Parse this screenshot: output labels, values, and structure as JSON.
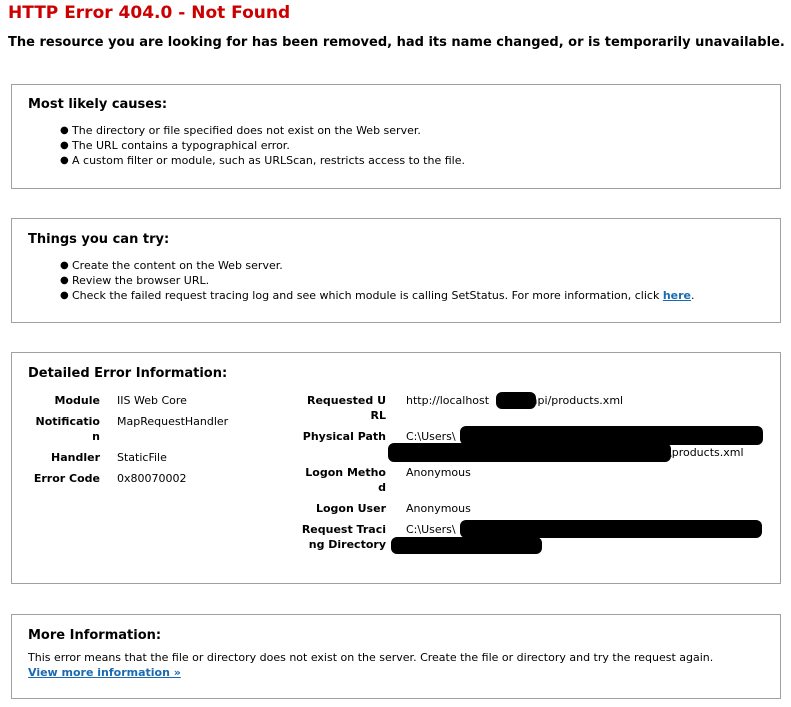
{
  "header": {
    "title": "HTTP Error 404.0 - Not Found",
    "subtitle": "The resource you are looking for has been removed, had its name changed, or is temporarily unavailable."
  },
  "causes": {
    "heading": "Most likely causes:",
    "items": [
      "The directory or file specified does not exist on the Web server.",
      "The URL contains a typographical error.",
      "A custom filter or module, such as URLScan, restricts access to the file."
    ]
  },
  "try": {
    "heading": "Things you can try:",
    "items": [
      "Create the content on the Web server.",
      "Review the browser URL.",
      "Check the failed request tracing log and see which module is calling SetStatus. For more information, click "
    ],
    "link_text": "here",
    "link_suffix": "."
  },
  "details": {
    "heading": "Detailed Error Information:",
    "module_label": "Module",
    "module_value": "IIS Web Core",
    "notification_label": "Notification",
    "notification_value": "MapRequestHandler",
    "handler_label": "Handler",
    "handler_value": "StaticFile",
    "error_code_label": "Error Code",
    "error_code_value": "0x80070002",
    "requested_url_label": "Requested URL",
    "requested_url_prefix": "http://localhost",
    "requested_url_suffix": "/api/products.xml",
    "physical_path_label": "Physical Path",
    "physical_path_prefix": "C:\\Users\\",
    "physical_path_suffix": "\\products.xml",
    "logon_method_label": "Logon Method",
    "logon_method_value": "Anonymous",
    "logon_user_label": "Logon User",
    "logon_user_value": "Anonymous",
    "tracing_dir_label": "Request Tracing Directory",
    "tracing_dir_prefix": "C:\\Users\\"
  },
  "more": {
    "heading": "More Information:",
    "text": "This error means that the file or directory does not exist on the server. Create the file or directory and try the request again.",
    "link_text": "View more information »"
  }
}
